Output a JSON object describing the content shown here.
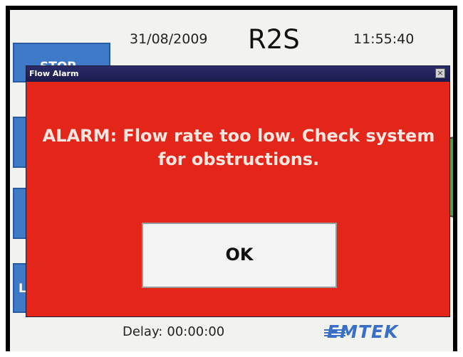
{
  "header": {
    "date": "31/08/2009",
    "unit_name": "R2S",
    "time": "11:55:40"
  },
  "side_buttons": [
    {
      "label": "STOP"
    },
    {
      "label": ""
    },
    {
      "label": ""
    },
    {
      "label": "L"
    }
  ],
  "footer": {
    "delay_label": "Delay:",
    "delay_value": "00:00:00",
    "brand": "EMTEK"
  },
  "dialog": {
    "title": "Flow Alarm",
    "close_glyph": "×",
    "message": "ALARM: Flow rate too low.  Check system for obstructions.",
    "ok_label": "OK"
  },
  "colors": {
    "dialog_bg": "#e4251a",
    "titlebar": "#1b1b4c",
    "side_button": "#3f7ac9",
    "brand": "#3a6fc8"
  }
}
